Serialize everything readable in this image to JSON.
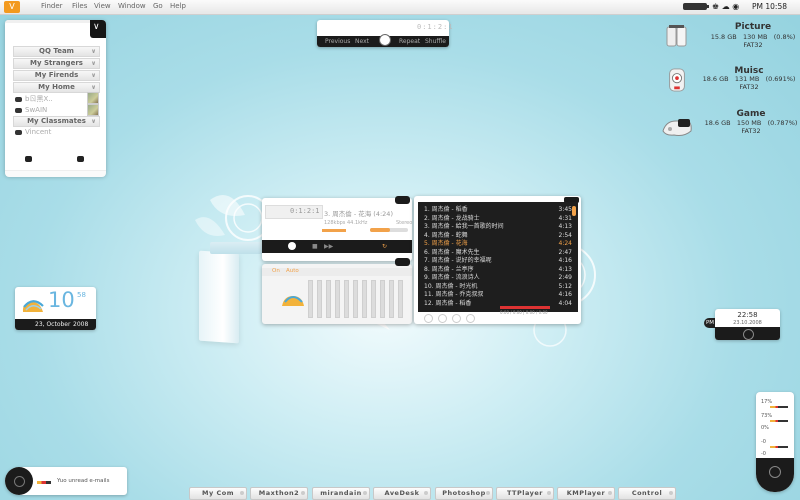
{
  "menubar": {
    "logo": "V",
    "items": [
      "Finder",
      "Files",
      "View",
      "Window",
      "Go",
      "Help"
    ],
    "tray_icons": "♚ ☁ ◉",
    "clock": "PM 10:58"
  },
  "buddy": {
    "groups": [
      "QQ Team",
      "My Strangers",
      "My Firends",
      "My Home",
      "My Classmates"
    ],
    "contacts": [
      "bㄖ黑X..",
      "SwAIN",
      "Vincent"
    ]
  },
  "mini_player": {
    "time": "0:1:2:1",
    "controls": [
      "Previous",
      "Next",
      "Repeat",
      "Shuffle"
    ]
  },
  "drives": [
    {
      "name": "Picture",
      "total": "15.8 GB",
      "used": "130 MB",
      "pct": "(0.8%)",
      "fs": "FAT32"
    },
    {
      "name": "Muisc",
      "total": "18.6 GB",
      "used": "131 MB",
      "pct": "(0.691%)",
      "fs": "FAT32"
    },
    {
      "name": "Game",
      "total": "18.6 GB",
      "used": "150 MB",
      "pct": "(0.787%)",
      "fs": "FAT32"
    }
  ],
  "player": {
    "track_title": "3. 周杰倫 - 花海 (4:24)",
    "time_display": "0:1:2:1",
    "bitrate": "128kbps",
    "samplerate": "44.1kHz",
    "mode": "Stereo",
    "eq_on": "On",
    "eq_auto": "Auto"
  },
  "playlist": [
    {
      "title": "1. 周杰倫 - 稻香",
      "dur": "3:45"
    },
    {
      "title": "2. 周杰倫 - 龙战骑士",
      "dur": "4:31"
    },
    {
      "title": "3. 周杰倫 - 給我一首歌的时间",
      "dur": "4:13"
    },
    {
      "title": "4. 周杰倫 - 蛇舞",
      "dur": "2:54"
    },
    {
      "title": "5. 周杰倫 - 花海",
      "dur": "4:24"
    },
    {
      "title": "6. 周杰倫 - 魔术先生",
      "dur": "2:47"
    },
    {
      "title": "7. 周杰倫 - 说好的幸福呢",
      "dur": "4:16"
    },
    {
      "title": "8. 周杰倫 - 兰亭序",
      "dur": "4:13"
    },
    {
      "title": "9. 周杰倫 - 流浪诗人",
      "dur": "2:49"
    },
    {
      "title": "10. 周杰倫 - 时光机",
      "dur": "5:12"
    },
    {
      "title": "11. 周杰倫 - 乔克叔叔",
      "dur": "4:16"
    },
    {
      "title": "12. 周杰倫 - 稻香",
      "dur": "4:04"
    }
  ],
  "playlist_active_index": 4,
  "playlist_footer": "0:00 / 0:00 | 0:00 / 0:00",
  "weather": {
    "temp": "10",
    "small": "58",
    "date_day": "23, October",
    "date_year": "2008"
  },
  "rclock": {
    "time": "22:58",
    "date": "23.10.2008",
    "badge": "PM"
  },
  "gauge": {
    "labels": [
      "17%",
      "73%",
      "0%",
      "-0",
      "-0"
    ]
  },
  "mail": {
    "text": "Yuo unread e-mails"
  },
  "dock": [
    "My Com",
    "Maxthon2",
    "mirandain",
    "AveDesk",
    "Photoshop",
    "TTPlayer",
    "KMPlayer",
    "Control"
  ],
  "colors": {
    "accent": "#f39a1f",
    "highlight": "#f2a24a",
    "weather_blue": "#6ab6e0",
    "dark": "#1b1b1b"
  }
}
